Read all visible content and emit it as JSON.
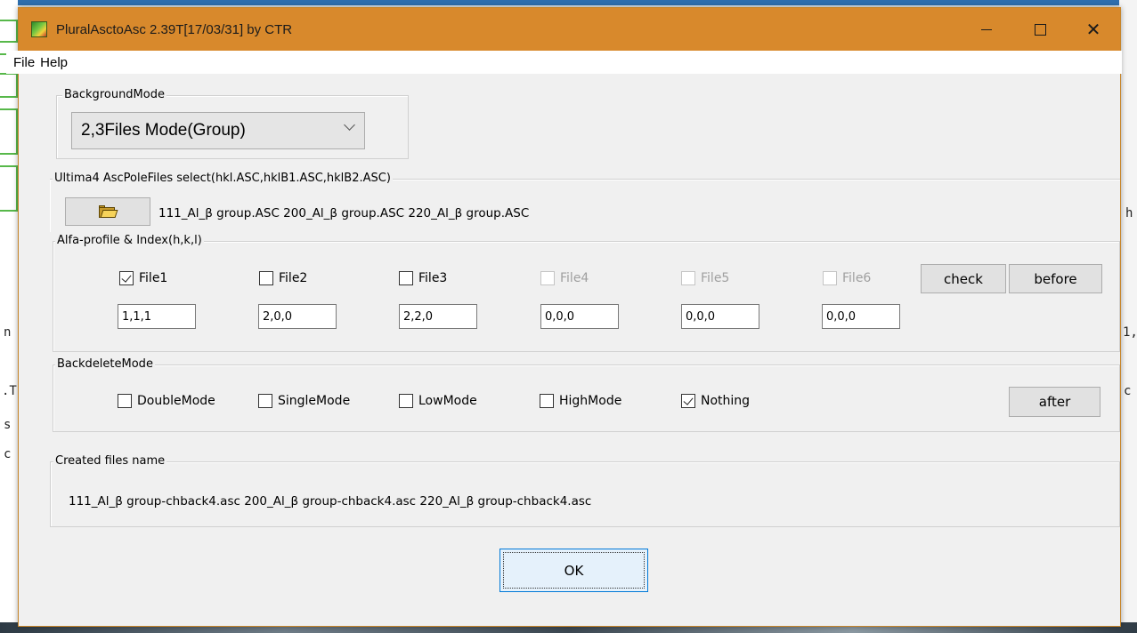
{
  "window": {
    "title": "PluralAsctoAsc 2.39T[17/03/31] by CTR",
    "minimize_label": "",
    "close_glyph": "✕"
  },
  "menu": {
    "file": "File",
    "help": "Help"
  },
  "background_mode": {
    "legend": "BackgroundMode",
    "selected": "2,3Files Mode(Group)"
  },
  "pole_files": {
    "legend": "Ultima4 AscPoleFiles select(hkl.ASC,hklB1.ASC,hklB2.ASC)",
    "files_text": "111_Al_β group.ASC  200_Al_β group.ASC  220_Al_β group.ASC"
  },
  "alfa_profile": {
    "legend": "Alfa-profile & Index(h,k,l)",
    "files": [
      {
        "label": "File1",
        "checked": true,
        "enabled": true,
        "index": "1,1,1"
      },
      {
        "label": "File2",
        "checked": false,
        "enabled": true,
        "index": "2,0,0"
      },
      {
        "label": "File3",
        "checked": false,
        "enabled": true,
        "index": "2,2,0"
      },
      {
        "label": "File4",
        "checked": false,
        "enabled": false,
        "index": "0,0,0"
      },
      {
        "label": "File5",
        "checked": false,
        "enabled": false,
        "index": "0,0,0"
      },
      {
        "label": "File6",
        "checked": false,
        "enabled": false,
        "index": "0,0,0"
      }
    ],
    "check_label": "check",
    "before_label": "before"
  },
  "backdelete_mode": {
    "legend": "BackdeleteMode",
    "options": [
      {
        "label": "DoubleMode",
        "checked": false
      },
      {
        "label": "SingleMode",
        "checked": false
      },
      {
        "label": "LowMode",
        "checked": false
      },
      {
        "label": "HighMode",
        "checked": false
      },
      {
        "label": "Nothing",
        "checked": true
      }
    ],
    "after_label": "after"
  },
  "created_files": {
    "legend": "Created files name",
    "text": "111_Al_β group-chback4.asc 200_Al_β group-chback4.asc 220_Al_β group-chback4.asc"
  },
  "ok_label": "OK",
  "background_fragments": [
    "n",
    ".T",
    "s",
    "c",
    "h",
    "1,",
    "c"
  ]
}
